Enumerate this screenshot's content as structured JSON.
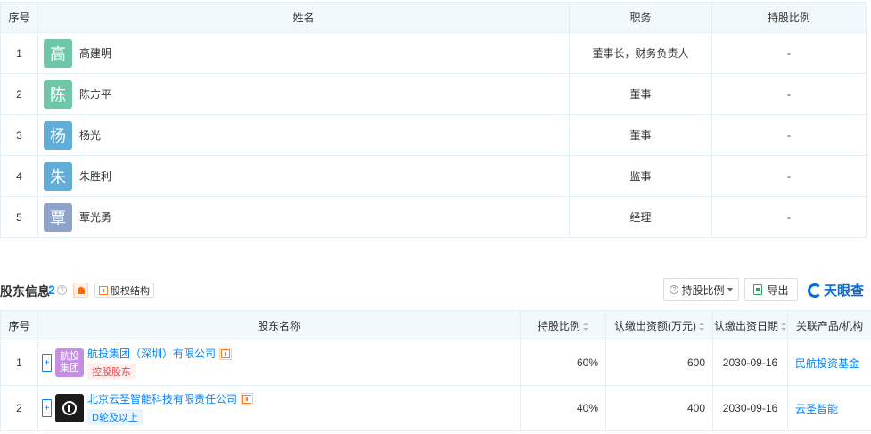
{
  "staff": {
    "headers": [
      "序号",
      "姓名",
      "职务",
      "持股比例"
    ],
    "rows": [
      {
        "no": "1",
        "avatar_char": "高",
        "avatar_color": "#6ec7a8",
        "name": "高建明",
        "position": "董事长，财务负责人",
        "ratio": "-"
      },
      {
        "no": "2",
        "avatar_char": "陈",
        "avatar_color": "#6ec7a8",
        "name": "陈方平",
        "position": "董事",
        "ratio": "-"
      },
      {
        "no": "3",
        "avatar_char": "杨",
        "avatar_color": "#62add8",
        "name": "杨光",
        "position": "董事",
        "ratio": "-"
      },
      {
        "no": "4",
        "avatar_char": "朱",
        "avatar_color": "#62add8",
        "name": "朱胜利",
        "position": "监事",
        "ratio": "-"
      },
      {
        "no": "5",
        "avatar_char": "覃",
        "avatar_color": "#8fa3c9",
        "name": "覃光勇",
        "position": "经理",
        "ratio": "-"
      }
    ]
  },
  "shareholders": {
    "title": "股东信息",
    "count": "2",
    "equity_button": "股权结构",
    "ratio_button": "持股比例",
    "export_button": "导出",
    "brand": "天眼查",
    "headers": [
      "序号",
      "股东名称",
      "持股比例",
      "认缴出资额(万元)",
      "认缴出资日期",
      "关联产品/机构"
    ],
    "rows": [
      {
        "no": "1",
        "logo_text": "航投集团",
        "name": "航投集团（深圳）有限公司",
        "tag": "控股股东",
        "ratio": "60%",
        "amount": "600",
        "date": "2030-09-16",
        "related": "民航投资基金"
      },
      {
        "no": "2",
        "logo_text": "",
        "name": "北京云圣智能科技有限责任公司",
        "tag": "D轮及以上",
        "ratio": "40%",
        "amount": "400",
        "date": "2030-09-16",
        "related": "云圣智能"
      }
    ]
  },
  "colors": {
    "accent": "#0084ff",
    "header_bg": "#f2f9fc",
    "border": "#e4eef6"
  }
}
